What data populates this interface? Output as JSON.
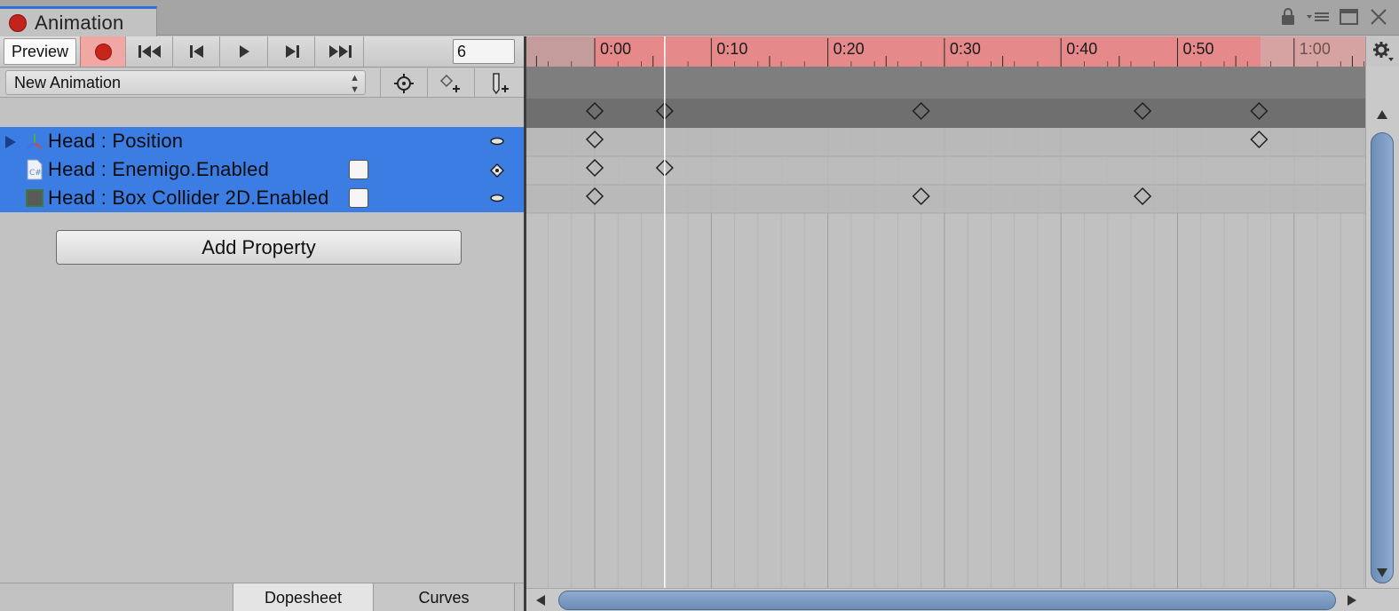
{
  "window": {
    "tab_title": "Animation"
  },
  "toolbar": {
    "preview_label": "Preview",
    "frame_value": "6",
    "buttons": [
      "record-icon",
      "first-key-icon",
      "prev-key-icon",
      "play-icon",
      "next-key-icon",
      "last-key-icon"
    ]
  },
  "clip": {
    "selected": "New Animation",
    "tools": [
      "filter-by-selection-icon",
      "add-keyframe-icon",
      "add-event-icon"
    ]
  },
  "properties": [
    {
      "label": "Head : Position",
      "icon": "transform-axes-icon",
      "checkbox": false,
      "expandable": true
    },
    {
      "label": "Head : Enemigo.Enabled",
      "icon": "csharp-script-icon",
      "checkbox": true,
      "expandable": false
    },
    {
      "label": "Head : Box Collider 2D.Enabled",
      "icon": "box-collider-icon",
      "checkbox": true,
      "expandable": false
    }
  ],
  "add_property_label": "Add Property",
  "bottom_tabs": [
    "Dopesheet",
    "Curves"
  ],
  "ruler": {
    "labels": [
      "0:00",
      "0:10",
      "0:20",
      "0:30",
      "0:40",
      "0:50",
      "1:00"
    ],
    "playhead_frame": 6,
    "keyframes": {
      "summary": [
        0,
        6,
        28,
        47,
        57
      ],
      "rows": [
        [
          0,
          57
        ],
        [
          0,
          6
        ],
        [
          0,
          28,
          47
        ]
      ]
    }
  },
  "colors": {
    "selection": "#3b7de3",
    "record_tint": "#e6898a",
    "record_dot": "#c7241c"
  }
}
